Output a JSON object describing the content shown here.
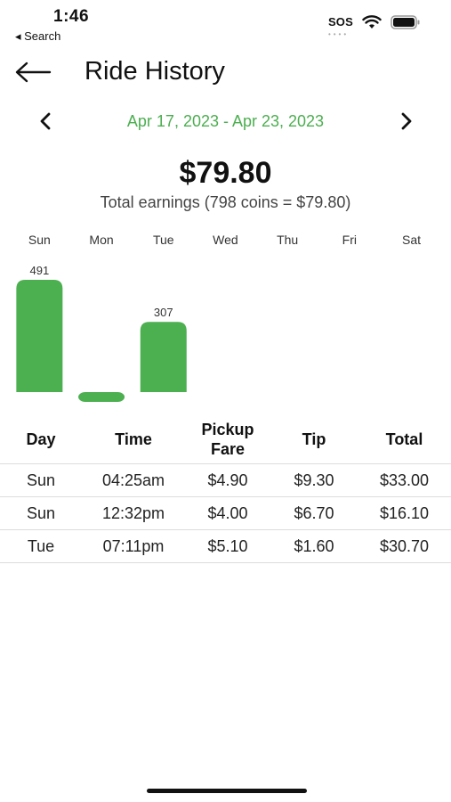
{
  "status_bar": {
    "time": "1:46",
    "back_label": "◂ Search",
    "sos": "SOS"
  },
  "header": {
    "title": "Ride History",
    "back_icon": "arrow-left-icon"
  },
  "date_nav": {
    "range": "Apr 17, 2023 - Apr 23, 2023",
    "prev_icon": "chevron-left-icon",
    "next_icon": "chevron-right-icon"
  },
  "summary": {
    "total": "$79.80",
    "caption": "Total earnings (798 coins = $79.80)"
  },
  "colors": {
    "accent": "#4caf50",
    "bar": "#4caf50"
  },
  "chart_data": {
    "type": "bar",
    "categories": [
      "Sun",
      "Mon",
      "Tue",
      "Wed",
      "Thu",
      "Fri",
      "Sat"
    ],
    "values": [
      491,
      0,
      307,
      0,
      0,
      0,
      0
    ],
    "labels": [
      "491",
      "",
      "307",
      "",
      "",
      "",
      ""
    ],
    "ylim": [
      0,
      491
    ],
    "grid": false
  },
  "table": {
    "headers": [
      "Day",
      "Time",
      "Pickup\nFare",
      "Tip",
      "Total"
    ],
    "rows": [
      [
        "Sun",
        "04:25am",
        "$4.90",
        "$9.30",
        "$33.00"
      ],
      [
        "Sun",
        "12:32pm",
        "$4.00",
        "$6.70",
        "$16.10"
      ],
      [
        "Tue",
        "07:11pm",
        "$5.10",
        "$1.60",
        "$30.70"
      ]
    ]
  }
}
